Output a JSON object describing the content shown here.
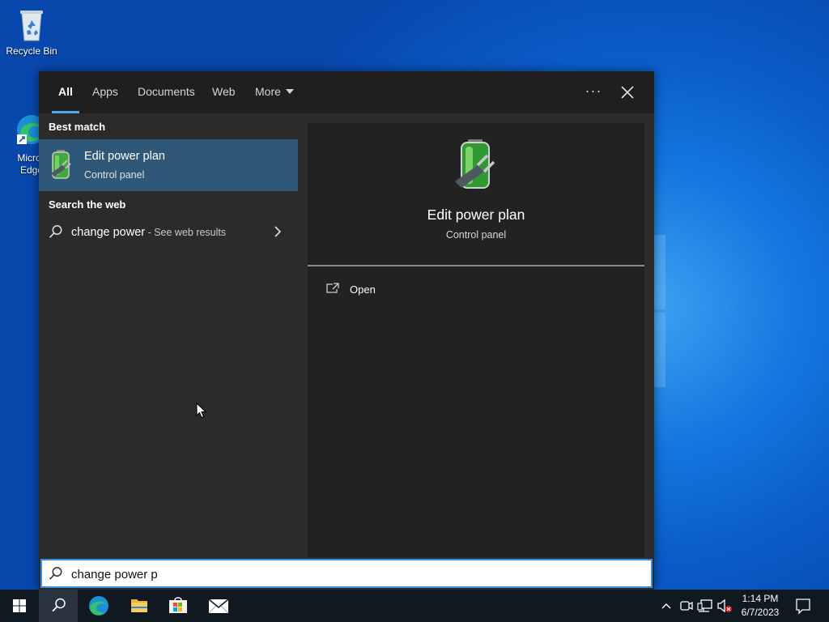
{
  "desktop": {
    "icons": [
      {
        "label": "Recycle Bin",
        "icon": "recycle-bin-icon"
      },
      {
        "label": "Micros\nEdge",
        "icon": "edge-icon"
      }
    ]
  },
  "search_panel": {
    "tabs": [
      {
        "label": "All",
        "active": true
      },
      {
        "label": "Apps"
      },
      {
        "label": "Documents"
      },
      {
        "label": "Web"
      },
      {
        "label": "More"
      }
    ],
    "more_options_label": "···",
    "best_match_heading": "Best match",
    "best_match": {
      "title": "Edit power plan",
      "subtitle": "Control panel",
      "icon": "battery-power-icon"
    },
    "web_heading": "Search the web",
    "web_result": {
      "query": "change power",
      "suffix": " - See web results"
    },
    "detail": {
      "title": "Edit power plan",
      "subtitle": "Control panel",
      "icon": "battery-power-icon"
    },
    "actions": [
      {
        "label": "Open",
        "icon": "open-icon"
      }
    ],
    "search_input": {
      "value": "change power p"
    }
  },
  "taskbar": {
    "clock_time": "1:14 PM",
    "clock_date": "6/7/2023"
  },
  "colors": {
    "accent": "#4aa7f0",
    "selected_row": "#2e5778",
    "panel_bg": "#2b2b2b",
    "detail_bg": "#222222",
    "taskbar_bg": "#101820"
  }
}
